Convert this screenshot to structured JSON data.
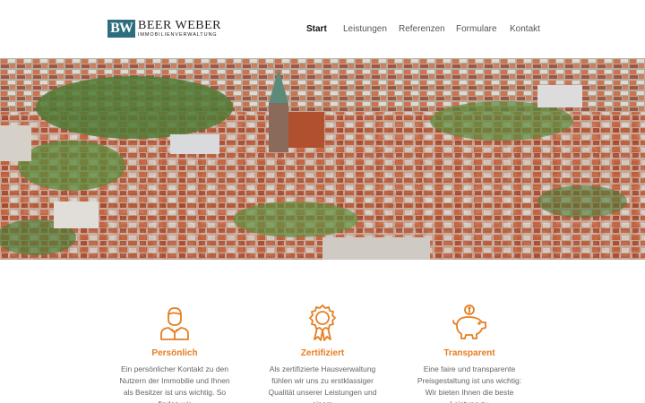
{
  "brand": {
    "mark": "BW",
    "name": "BEER WEBER",
    "subtitle": "IMMOBILIENVERWALTUNG",
    "color": "#2d6e7e"
  },
  "nav": {
    "items": [
      {
        "label": "Start",
        "active": true
      },
      {
        "label": "Leistungen",
        "active": false
      },
      {
        "label": "Referenzen",
        "active": false
      },
      {
        "label": "Formulare",
        "active": false
      },
      {
        "label": "Kontakt",
        "active": false
      }
    ]
  },
  "hero": {
    "image": "aerial-city-view"
  },
  "features": [
    {
      "icon": "person-icon",
      "title": "Persönlich",
      "text": "Ein persönlicher Kontakt zu den Nutzern der Immobilie und Ihnen als Besitzer ist uns wichtig. So finden wir"
    },
    {
      "icon": "award-icon",
      "title": "Zertifiziert",
      "text": "Als zertifizierte Hausverwaltung fühlen wir uns zu erstklassiger Qualität unserer Leistungen und einem"
    },
    {
      "icon": "piggy-bank-icon",
      "title": "Transparent",
      "text": "Eine faire und transparente Preisgestaltung ist uns wichtig: Wir bieten Ihnen die beste Leistung zu"
    }
  ],
  "colors": {
    "accent": "#e67e22",
    "text": "#555555"
  }
}
